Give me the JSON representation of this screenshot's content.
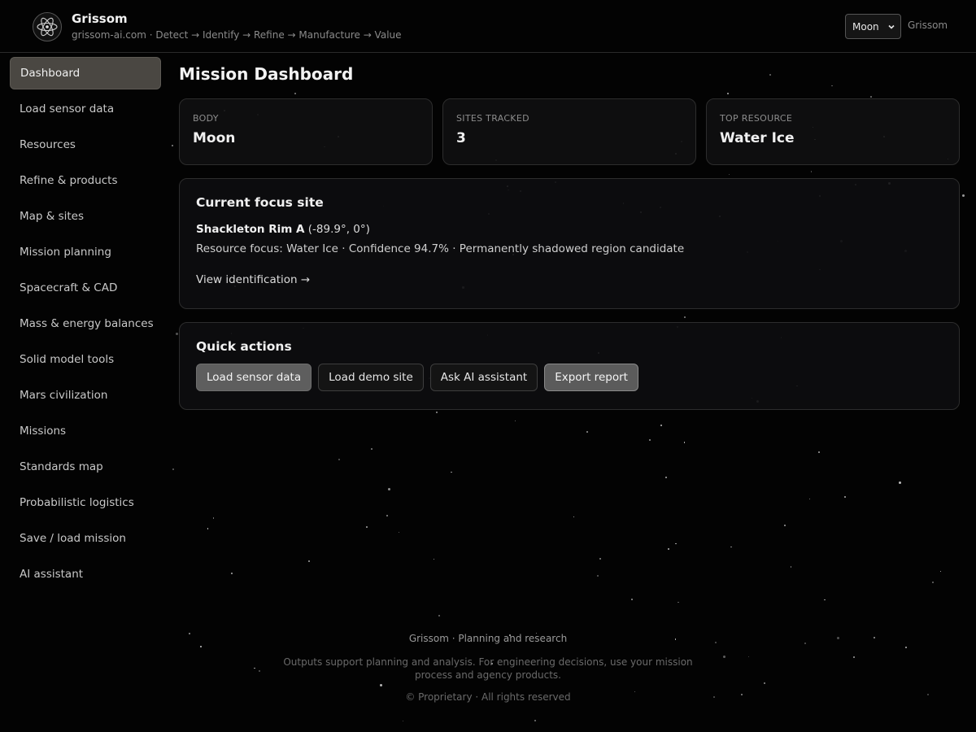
{
  "header": {
    "brand": "Grissom",
    "tagline": "grissom-ai.com · Detect → Identify → Refine → Manufacture → Value",
    "body_select": {
      "value": "Moon",
      "options": [
        "Moon"
      ]
    },
    "user": "Grissom"
  },
  "sidebar": {
    "items": [
      {
        "label": "Dashboard",
        "active": true
      },
      {
        "label": "Load sensor data"
      },
      {
        "label": "Resources"
      },
      {
        "label": "Refine & products"
      },
      {
        "label": "Map & sites"
      },
      {
        "label": "Mission planning"
      },
      {
        "label": "Spacecraft & CAD"
      },
      {
        "label": "Mass & energy balances"
      },
      {
        "label": "Solid model tools"
      },
      {
        "label": "Mars civilization"
      },
      {
        "label": "Missions"
      },
      {
        "label": "Standards map"
      },
      {
        "label": "Probabilistic logistics"
      },
      {
        "label": "Save / load mission"
      },
      {
        "label": "AI assistant"
      }
    ]
  },
  "main": {
    "title": "Mission Dashboard",
    "stats": [
      {
        "label": "BODY",
        "value": "Moon"
      },
      {
        "label": "SITES TRACKED",
        "value": "3"
      },
      {
        "label": "TOP RESOURCE",
        "value": "Water Ice"
      }
    ],
    "focus": {
      "title": "Current focus site",
      "site_name": "Shackleton Rim A",
      "site_coords": "(-89.9°, 0°)",
      "resource_line": "Resource focus: Water Ice · Confidence 94.7% · Permanently shadowed region candidate",
      "link": "View identification →"
    },
    "quick_actions": {
      "title": "Quick actions",
      "buttons": [
        "Load sensor data",
        "Load demo site",
        "Ask AI assistant",
        "Export report"
      ]
    }
  },
  "footer": {
    "line1": "Grissom · Planning and research",
    "line2": "Outputs support planning and analysis. For engineering decisions, use your mission process and agency products.",
    "line3": "© Proprietary · All rights reserved"
  },
  "colors": {
    "background": "#030303",
    "active_nav": "#4a4742",
    "card_border": "#2d2d2d",
    "primary_button": "#5e5e5e"
  }
}
